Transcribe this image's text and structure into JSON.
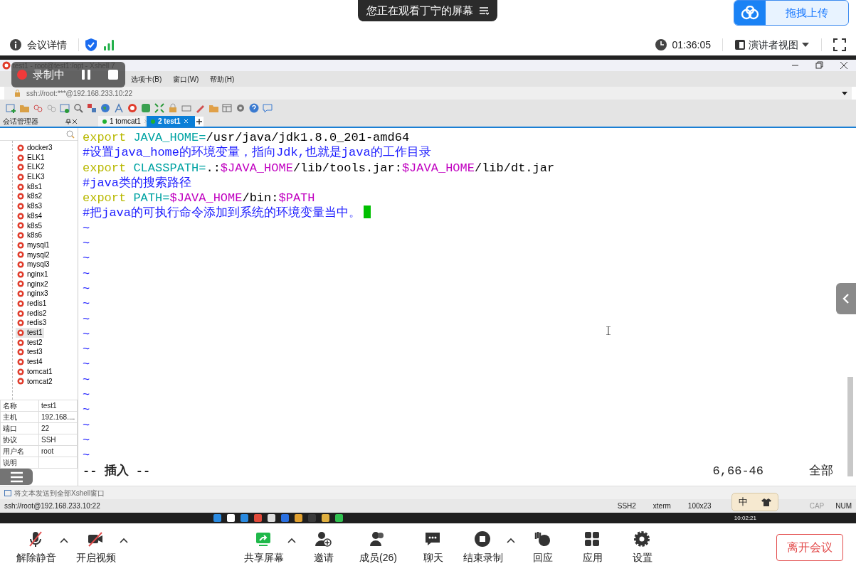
{
  "meeting_banner": {
    "text": "您正在观看丁宁的屏幕"
  },
  "upload_button": {
    "label": "拖拽上传"
  },
  "meeting_bar": {
    "details": "会议详情",
    "timer": "01:36:05",
    "view": "演讲者视图"
  },
  "recording": {
    "label": "录制中"
  },
  "xshell": {
    "title": "test1 - root@test1:/opt - Xshell 7",
    "menu": [
      "选项卡(B)",
      "窗口(W)",
      "帮助(H)"
    ],
    "address": "ssh://root:***@192.168.233.10:22",
    "session_panel_title": "会话管理器",
    "tabs": [
      {
        "number": "1",
        "label": "tomcat1",
        "selected": false
      },
      {
        "number": "2",
        "label": "test1",
        "selected": true
      }
    ],
    "sessions": [
      {
        "label": "docker3",
        "selected": false
      },
      {
        "label": "ELK1",
        "selected": false
      },
      {
        "label": "ELK2",
        "selected": false
      },
      {
        "label": "ELK3",
        "selected": false
      },
      {
        "label": "k8s1",
        "selected": false
      },
      {
        "label": "k8s2",
        "selected": false
      },
      {
        "label": "k8s3",
        "selected": false
      },
      {
        "label": "k8s4",
        "selected": false
      },
      {
        "label": "k8s5",
        "selected": false
      },
      {
        "label": "k8s6",
        "selected": false
      },
      {
        "label": "mysql1",
        "selected": false
      },
      {
        "label": "mysql2",
        "selected": false
      },
      {
        "label": "mysql3",
        "selected": false
      },
      {
        "label": "nginx1",
        "selected": false
      },
      {
        "label": "nginx2",
        "selected": false
      },
      {
        "label": "nginx3",
        "selected": false
      },
      {
        "label": "redis1",
        "selected": false
      },
      {
        "label": "redis2",
        "selected": false
      },
      {
        "label": "redis3",
        "selected": false
      },
      {
        "label": "test1",
        "selected": true
      },
      {
        "label": "test2",
        "selected": false
      },
      {
        "label": "test3",
        "selected": false
      },
      {
        "label": "test4",
        "selected": false
      },
      {
        "label": "tomcat1",
        "selected": false
      },
      {
        "label": "tomcat2",
        "selected": false
      }
    ],
    "properties": [
      {
        "key": "名称",
        "value": "test1"
      },
      {
        "key": "主机",
        "value": "192.168...."
      },
      {
        "key": "端口",
        "value": "22"
      },
      {
        "key": "协议",
        "value": "SSH"
      },
      {
        "key": "用户名",
        "value": "root"
      },
      {
        "key": "说明"
      }
    ],
    "terminal": {
      "lines": [
        {
          "cursor": false,
          "segments": [
            {
              "text": "export ",
              "color": "#b8b800"
            },
            {
              "text": "JAVA_HOME=",
              "color": "#00a3a3"
            },
            {
              "text": "/usr/java/jdk1.8.0_201-amd64",
              "color": "#000000"
            }
          ]
        },
        {
          "cursor": false,
          "segments": [
            {
              "text": "#设置java_home的环境变量，指向Jdk,也就是java的工作目录",
              "color": "#1a1aff"
            }
          ]
        },
        {
          "cursor": false,
          "segments": [
            {
              "text": "export ",
              "color": "#b8b800"
            },
            {
              "text": "CLASSPATH=",
              "color": "#00a3a3"
            },
            {
              "text": ".:",
              "color": "#000000"
            },
            {
              "text": "$JAVA_HOME",
              "color": "#c000c0"
            },
            {
              "text": "/lib/tools.jar:",
              "color": "#000000"
            },
            {
              "text": "$JAVA_HOME",
              "color": "#c000c0"
            },
            {
              "text": "/lib/dt.jar",
              "color": "#000000"
            }
          ]
        },
        {
          "cursor": false,
          "segments": [
            {
              "text": "#java类的搜索路径",
              "color": "#1a1aff"
            }
          ]
        },
        {
          "cursor": false,
          "segments": [
            {
              "text": "export ",
              "color": "#b8b800"
            },
            {
              "text": "PATH=",
              "color": "#00a3a3"
            },
            {
              "text": "$JAVA_HOME",
              "color": "#c000c0"
            },
            {
              "text": "/bin:",
              "color": "#000000"
            },
            {
              "text": "$PATH",
              "color": "#c000c0"
            }
          ]
        },
        {
          "cursor": true,
          "segments": [
            {
              "text": "#把java的可执行命令添加到系统的环境变量当中。",
              "color": "#1a1aff"
            }
          ]
        }
      ],
      "empty_lines": [
        "~",
        "~",
        "~",
        "~",
        "~",
        "~",
        "~",
        "~",
        "~",
        "~",
        "~",
        "~",
        "~",
        "~",
        "~",
        "~"
      ],
      "mode": "-- 插入 --",
      "position": "6,66-46",
      "scroll": "全部"
    },
    "send_bar": "将文本发送到全部Xshell窗口",
    "status": {
      "address": "ssh://root@192.168.233.10:22",
      "items": [
        {
          "label": "SSH2",
          "on": true
        },
        {
          "label": "xterm",
          "on": true
        },
        {
          "label": "100x23",
          "on": true
        },
        {
          "label": "CAP",
          "on": false
        },
        {
          "label": "NUM",
          "on": true
        }
      ]
    }
  },
  "ime": {
    "label": "中"
  },
  "taskbar": {
    "time": "10:02:21"
  },
  "toolbar": {
    "buttons": [
      {
        "label": "解除静音",
        "kind": "mic",
        "caret": true
      },
      {
        "label": "开启视频",
        "kind": "camera",
        "caret": true
      },
      {
        "label": "共享屏幕",
        "kind": "share",
        "caret": true
      },
      {
        "label": "邀请",
        "kind": "invite",
        "caret": false
      },
      {
        "label": "成员(26)",
        "kind": "members",
        "caret": false
      },
      {
        "label": "聊天",
        "kind": "chat",
        "caret": false
      },
      {
        "label": "结束录制",
        "kind": "record",
        "caret": true
      },
      {
        "label": "回应",
        "kind": "react",
        "caret": false
      },
      {
        "label": "应用",
        "kind": "apps",
        "caret": false
      },
      {
        "label": "设置",
        "kind": "settings",
        "caret": false
      }
    ],
    "leave": "离开会议"
  }
}
